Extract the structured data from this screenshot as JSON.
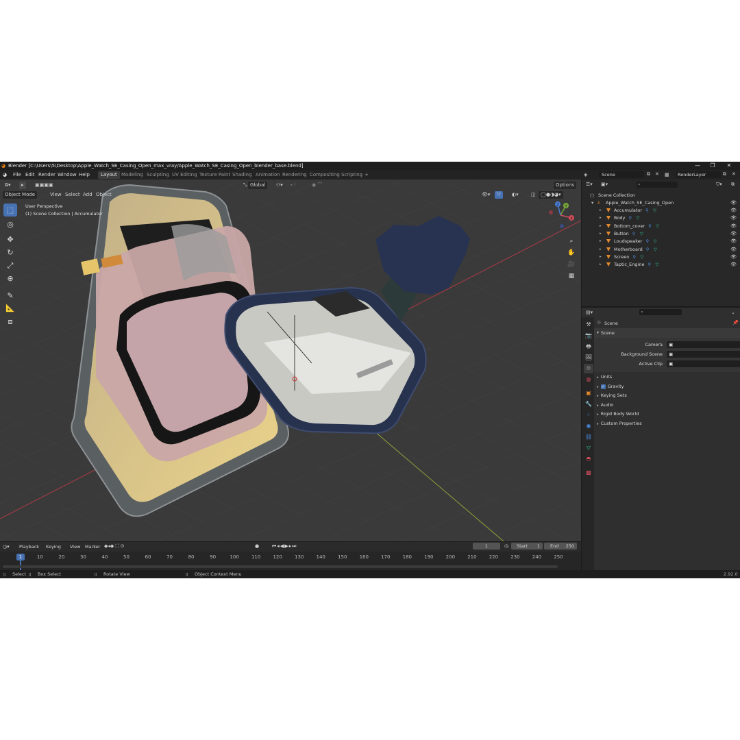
{
  "window": {
    "title": "Blender [C:\\Users\\5\\Desktop\\Apple_Watch_SE_Casing_Open_max_vray/Apple_Watch_SE_Casing_Open_blender_base.blend]",
    "minimize": "—",
    "maximize": "❐",
    "close": "✕"
  },
  "menu": [
    "File",
    "Edit",
    "Render",
    "Window",
    "Help"
  ],
  "workspaces": [
    "Layout",
    "Modeling",
    "Sculpting",
    "UV Editing",
    "Texture Paint",
    "Shading",
    "Animation",
    "Rendering",
    "Compositing",
    "Scripting"
  ],
  "add_workspace": "+",
  "scene_selector": "Scene",
  "renderlayer_selector": "RenderLayer",
  "viewport": {
    "mode": "Object Mode",
    "menus": [
      "View",
      "Select",
      "Add",
      "Object"
    ],
    "transform_orientation": "Global",
    "options": "Options",
    "perspective_label": "User Perspective",
    "collection_label": "(1) Scene Collection | Accumulator",
    "gizmo": {
      "x": "X",
      "y": "Y",
      "z": "Z"
    }
  },
  "timeline": {
    "menus": [
      "Playback",
      "Keying",
      "View",
      "Marker"
    ],
    "current_frame": "1",
    "start_label": "Start",
    "start": "1",
    "end_label": "End",
    "end": "250",
    "ticks": [
      "1",
      "10",
      "20",
      "30",
      "40",
      "50",
      "60",
      "70",
      "80",
      "90",
      "100",
      "110",
      "120",
      "130",
      "140",
      "150",
      "160",
      "170",
      "180",
      "190",
      "200",
      "210",
      "220",
      "230",
      "240",
      "250"
    ]
  },
  "outliner": {
    "root": "Scene Collection",
    "collection": "Apple_Watch_SE_Casing_Open",
    "objects": [
      "Accumulator",
      "Body",
      "Bottom_cover",
      "Button",
      "Loudspeaker",
      "Motherboard",
      "Screen",
      "Taptic_Engine"
    ]
  },
  "properties": {
    "context": "Scene",
    "panel": "Scene",
    "fields": [
      {
        "label": "Camera",
        "value": ""
      },
      {
        "label": "Background Scene",
        "value": ""
      },
      {
        "label": "Active Clip",
        "value": ""
      }
    ],
    "sections": [
      "Units",
      "Gravity",
      "Keying Sets",
      "Audio",
      "Rigid Body World",
      "Custom Properties"
    ]
  },
  "statusbar": {
    "select": "Select",
    "box_select": "Box Select",
    "rotate": "Rotate View",
    "context_menu": "Object Context Menu",
    "version": "2.92.0"
  },
  "colors": {
    "accent": "#4772b3",
    "object_icon": "#e38a2c",
    "mesh_icon": "#33c3a0"
  }
}
